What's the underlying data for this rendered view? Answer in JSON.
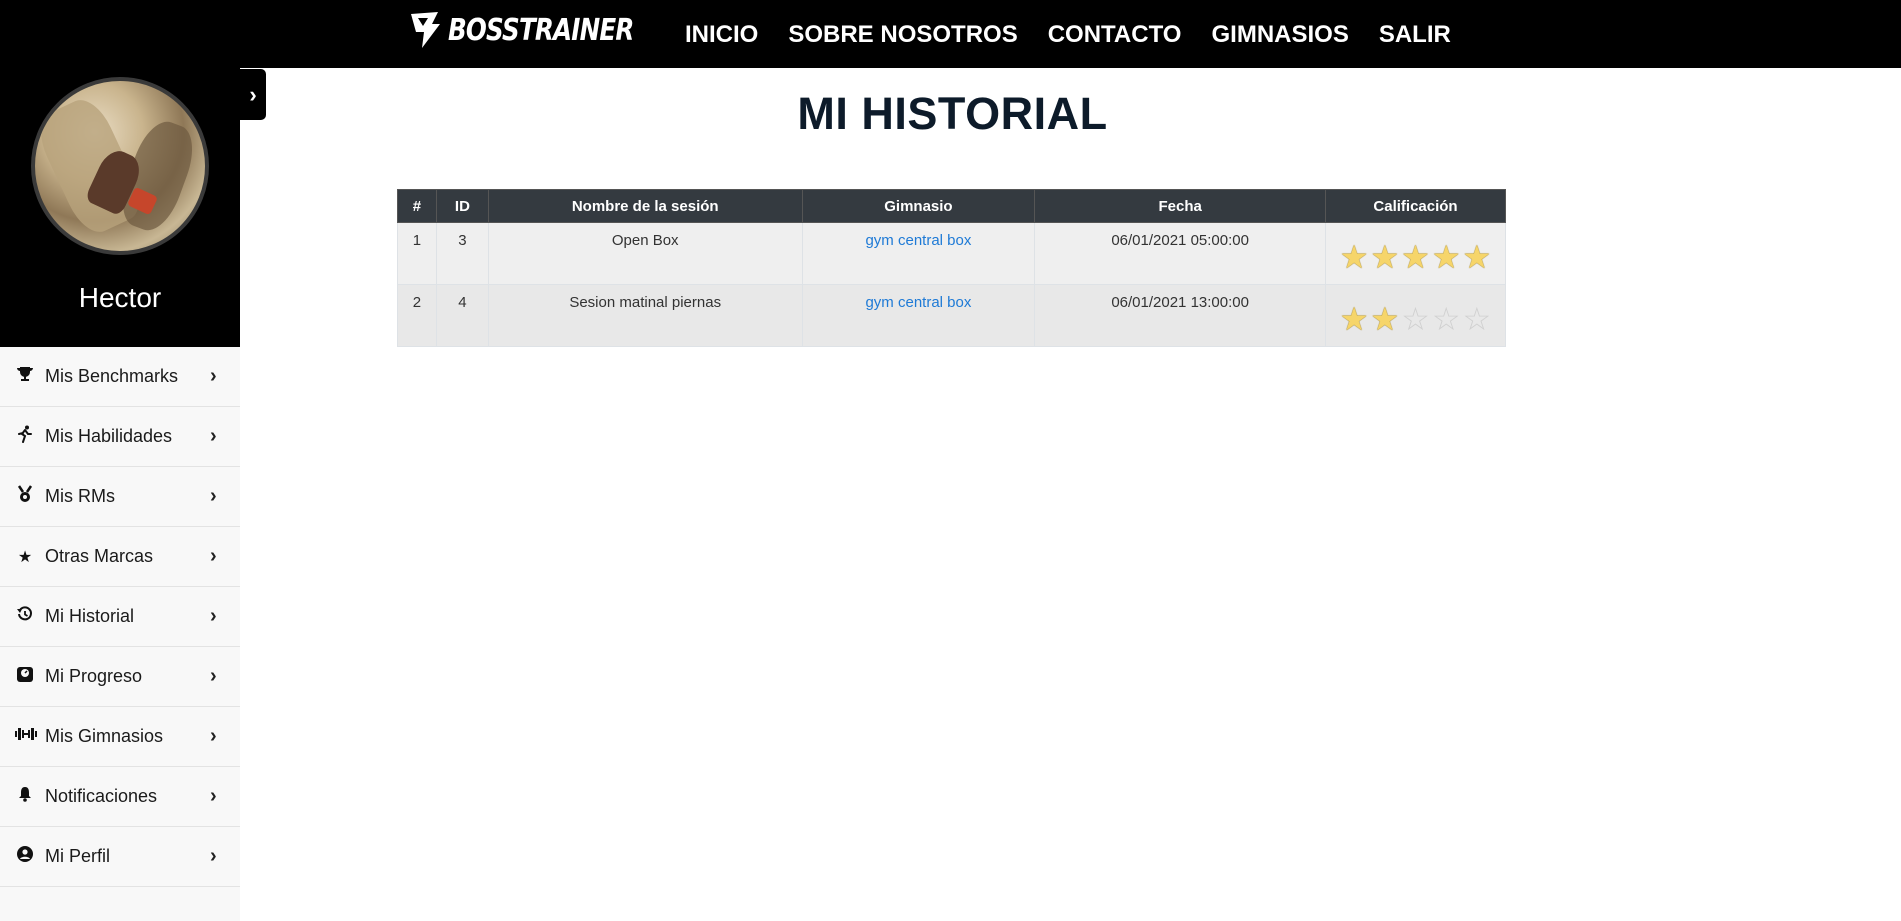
{
  "brand": {
    "name": "BOSSTRAINER"
  },
  "nav": [
    "INICIO",
    "SOBRE NOSOTROS",
    "CONTACTO",
    "GIMNASIOS",
    "SALIR"
  ],
  "sidebar": {
    "username": "Hector",
    "toggle_icon": "chevron-right-icon",
    "items": [
      {
        "label": "Mis Benchmarks",
        "icon": "trophy-icon"
      },
      {
        "label": "Mis Habilidades",
        "icon": "running-icon"
      },
      {
        "label": "Mis RMs",
        "icon": "medal-icon"
      },
      {
        "label": "Otras Marcas",
        "icon": "star-icon"
      },
      {
        "label": "Mi Historial",
        "icon": "history-icon"
      },
      {
        "label": "Mi Progreso",
        "icon": "weight-icon"
      },
      {
        "label": "Mis Gimnasios",
        "icon": "dumbbell-icon"
      },
      {
        "label": "Notificaciones",
        "icon": "bell-icon"
      },
      {
        "label": "Mi Perfil",
        "icon": "user-circle-icon"
      }
    ]
  },
  "page": {
    "title": "MI HISTORIAL"
  },
  "table": {
    "headers": [
      "#",
      "ID",
      "Nombre de la sesión",
      "Gimnasio",
      "Fecha",
      "Calificación"
    ],
    "rows": [
      {
        "num": "1",
        "id": "3",
        "session": "Open Box",
        "gym": "gym central box",
        "date": "06/01/2021 05:00:00",
        "rating": 5
      },
      {
        "num": "2",
        "id": "4",
        "session": "Sesion matinal piernas",
        "gym": "gym central box",
        "date": "06/01/2021 13:00:00",
        "rating": 2
      }
    ],
    "rating_max": 5
  }
}
